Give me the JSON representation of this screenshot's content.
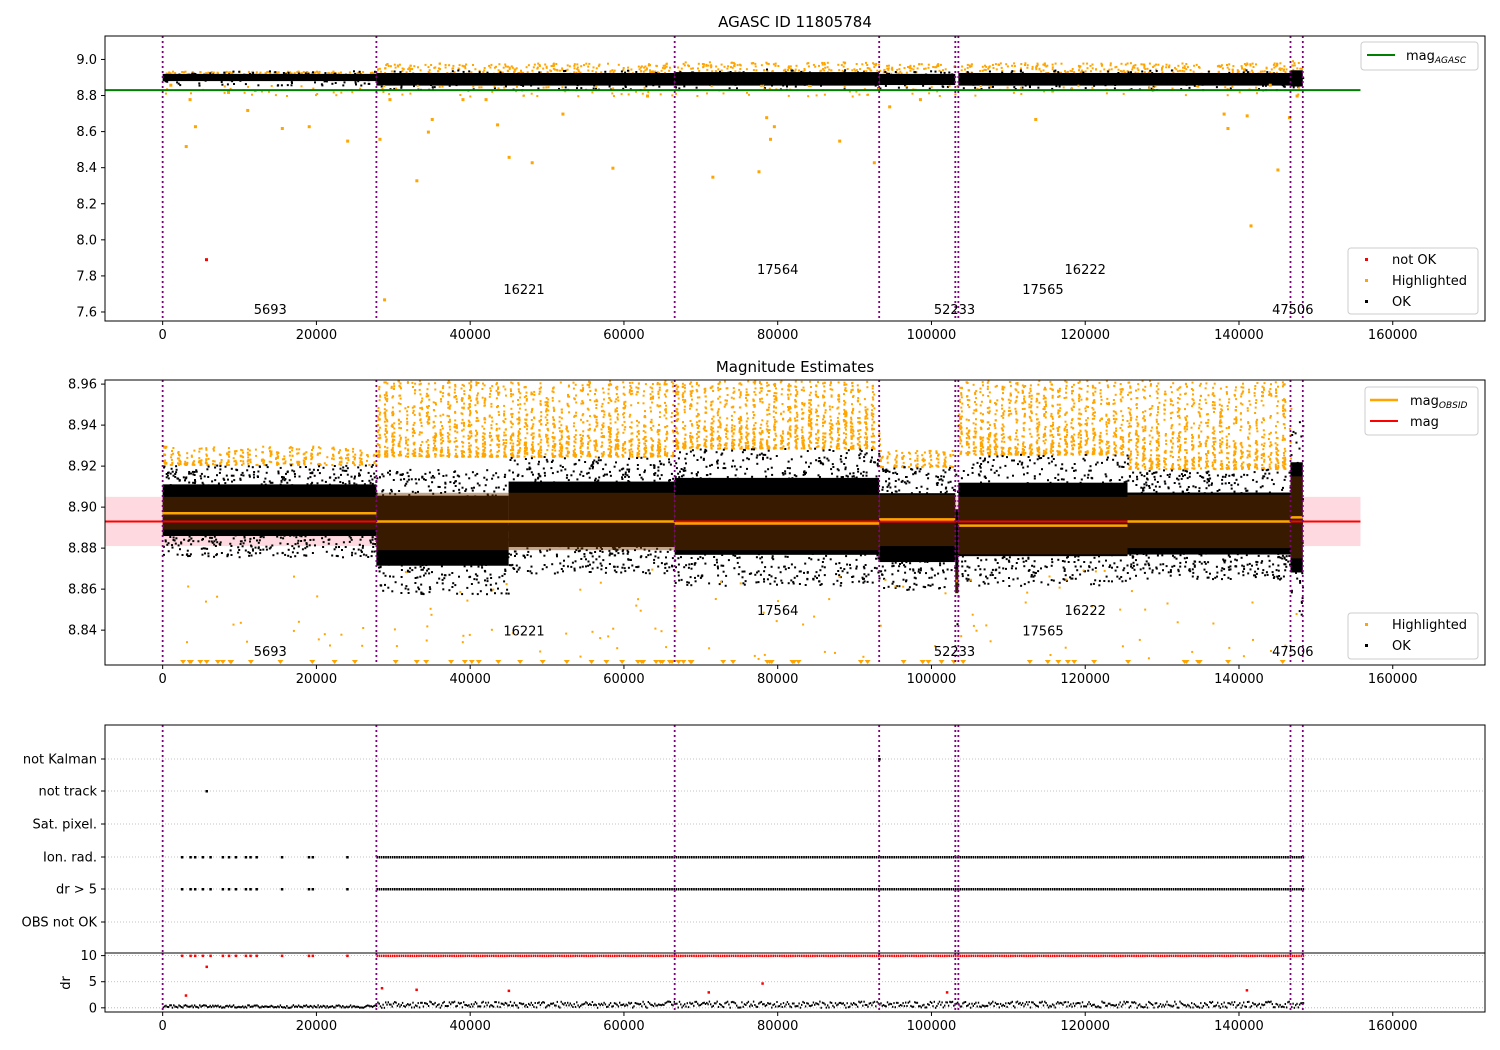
{
  "figure": {
    "panel1_title": "AGASC ID 11805784",
    "panel2_title": "Magnitude Estimates"
  },
  "colors": {
    "ok": "#000000",
    "highlighted": "#ffa500",
    "not_ok": "#ff0000",
    "mag_agasc": "#008000",
    "mag_line": "#ff0000",
    "mag_band": "#ffc0cb",
    "obsid_band": "#7a3a00",
    "obsid_line": "#ffa500",
    "boundary": "#800080",
    "grid": "#b0b0b0"
  },
  "chart_data": [
    {
      "type": "scatter",
      "title": "AGASC ID 11805784",
      "xlabel": "",
      "ylabel": "",
      "xlim": [
        -7500,
        172000
      ],
      "ylim": [
        7.55,
        9.13
      ],
      "xticks": [
        0,
        20000,
        40000,
        60000,
        80000,
        100000,
        120000,
        140000,
        160000
      ],
      "xtick_labels": [
        "0",
        "20000",
        "40000",
        "60000",
        "80000",
        "100000",
        "120000",
        "140000",
        "160000"
      ],
      "yticks": [
        7.6,
        7.8,
        8.0,
        8.2,
        8.4,
        8.6,
        8.8,
        9.0
      ],
      "ytick_labels": [
        "7.6",
        "7.8",
        "8.0",
        "8.2",
        "8.4",
        "8.6",
        "8.8",
        "9.0"
      ],
      "hlines": [
        {
          "name": "mag_AGASC",
          "y": 8.83,
          "x": [
            -7500,
            155800
          ]
        }
      ],
      "obsid_boundaries": [
        0,
        27800,
        66600,
        93200,
        103100,
        103500,
        146700,
        148300
      ],
      "obsid_labels": [
        {
          "text": "5693",
          "x": 14000,
          "y": 7.59
        },
        {
          "text": "16221",
          "x": 47000,
          "y": 7.7
        },
        {
          "text": "17564",
          "x": 80000,
          "y": 7.81
        },
        {
          "text": "52233",
          "x": 103000,
          "y": 7.59
        },
        {
          "text": "17565",
          "x": 114500,
          "y": 7.7
        },
        {
          "text": "16222",
          "x": 120000,
          "y": 7.81
        },
        {
          "text": "47506",
          "x": 147000,
          "y": 7.59
        }
      ],
      "ok_band_segments": [
        {
          "x": [
            0,
            27800
          ],
          "y_low": 8.88,
          "y_high": 8.92
        },
        {
          "x": [
            27800,
            66600
          ],
          "y_low": 8.855,
          "y_high": 8.925
        },
        {
          "x": [
            66600,
            93200
          ],
          "y_low": 8.855,
          "y_high": 8.93
        },
        {
          "x": [
            93200,
            103100
          ],
          "y_low": 8.858,
          "y_high": 8.92
        },
        {
          "x": [
            103500,
            146700
          ],
          "y_low": 8.855,
          "y_high": 8.925
        },
        {
          "x": [
            146700,
            148300
          ],
          "y_low": 8.85,
          "y_high": 8.94
        }
      ],
      "highlighted_outliers": [
        [
          1000,
          8.86
        ],
        [
          3000,
          8.52
        ],
        [
          3500,
          8.78
        ],
        [
          4200,
          8.63
        ],
        [
          8500,
          8.82
        ],
        [
          11000,
          8.72
        ],
        [
          15500,
          8.62
        ],
        [
          19000,
          8.63
        ],
        [
          24000,
          8.55
        ],
        [
          28200,
          8.56
        ],
        [
          28800,
          7.67
        ],
        [
          29500,
          8.78
        ],
        [
          33000,
          8.33
        ],
        [
          34500,
          8.6
        ],
        [
          35000,
          8.67
        ],
        [
          39000,
          8.78
        ],
        [
          42000,
          8.78
        ],
        [
          43500,
          8.64
        ],
        [
          45000,
          8.46
        ],
        [
          48000,
          8.43
        ],
        [
          52000,
          8.7
        ],
        [
          58500,
          8.4
        ],
        [
          63000,
          8.8
        ],
        [
          71500,
          8.35
        ],
        [
          77500,
          8.38
        ],
        [
          78500,
          8.68
        ],
        [
          79000,
          8.56
        ],
        [
          79500,
          8.63
        ],
        [
          88000,
          8.55
        ],
        [
          92500,
          8.43
        ],
        [
          94500,
          8.74
        ],
        [
          98500,
          8.78
        ],
        [
          113500,
          8.67
        ],
        [
          138000,
          8.7
        ],
        [
          138500,
          8.62
        ],
        [
          141000,
          8.69
        ],
        [
          141500,
          8.08
        ],
        [
          144000,
          8.86
        ],
        [
          145000,
          8.39
        ],
        [
          146500,
          8.68
        ],
        [
          147500,
          8.8
        ]
      ],
      "not_ok_points": [
        [
          5700,
          7.89
        ]
      ],
      "legend": {
        "location": "upper right / lower right",
        "entries": [
          "mag_AGASC",
          "not OK",
          "Highlighted",
          "OK"
        ]
      }
    },
    {
      "type": "scatter",
      "title": "Magnitude Estimates",
      "xlabel": "",
      "ylabel": "",
      "xlim": [
        -7500,
        172000
      ],
      "ylim": [
        8.823,
        8.962
      ],
      "xticks": [
        0,
        20000,
        40000,
        60000,
        80000,
        100000,
        120000,
        140000,
        160000
      ],
      "xtick_labels": [
        "0",
        "20000",
        "40000",
        "60000",
        "80000",
        "100000",
        "120000",
        "140000",
        "160000"
      ],
      "yticks": [
        8.84,
        8.86,
        8.88,
        8.9,
        8.92,
        8.94,
        8.96
      ],
      "ytick_labels": [
        "8.84",
        "8.86",
        "8.88",
        "8.90",
        "8.92",
        "8.94",
        "8.96"
      ],
      "mag": {
        "value": 8.893,
        "band": [
          8.881,
          8.905
        ],
        "x": [
          -7500,
          155800
        ]
      },
      "mag_obsid": [
        {
          "x": [
            0,
            27800
          ],
          "value": 8.897,
          "band": [
            8.889,
            8.905
          ]
        },
        {
          "x": [
            27800,
            66600
          ],
          "value": 8.893,
          "band": [
            8.879,
            8.907
          ]
        },
        {
          "x": [
            66600,
            93200
          ],
          "value": 8.892,
          "band": [
            8.879,
            8.906
          ]
        },
        {
          "x": [
            93200,
            103100
          ],
          "value": 8.894,
          "band": [
            8.881,
            8.906
          ]
        },
        {
          "x": [
            103100,
            103500
          ],
          "value": 8.864,
          "band": [
            8.858,
            8.87
          ]
        },
        {
          "x": [
            103500,
            125500
          ],
          "value": 8.891,
          "band": [
            8.877,
            8.905
          ]
        },
        {
          "x": [
            125500,
            146700
          ],
          "value": 8.893,
          "band": [
            8.88,
            8.906
          ]
        },
        {
          "x": [
            146700,
            148300
          ],
          "value": 8.895,
          "band": [
            8.875,
            8.915
          ]
        }
      ],
      "obsid_boundaries": [
        0,
        27800,
        66600,
        93200,
        103100,
        103500,
        146700,
        148300
      ],
      "obsid_labels": [
        {
          "text": "5693",
          "x": 14000,
          "y": 8.8275
        },
        {
          "text": "16221",
          "x": 47000,
          "y": 8.8375
        },
        {
          "text": "17564",
          "x": 80000,
          "y": 8.8475
        },
        {
          "text": "52233",
          "x": 103000,
          "y": 8.8275
        },
        {
          "text": "17565",
          "x": 114500,
          "y": 8.8375
        },
        {
          "text": "16222",
          "x": 120000,
          "y": 8.8475
        },
        {
          "text": "47506",
          "x": 147000,
          "y": 8.8275
        }
      ],
      "ok_spread": [
        {
          "x": [
            0,
            27800
          ],
          "low": 8.876,
          "high": 8.921
        },
        {
          "x": [
            27800,
            45000
          ],
          "low": 8.858,
          "high": 8.919
        },
        {
          "x": [
            45000,
            66600
          ],
          "low": 8.868,
          "high": 8.925
        },
        {
          "x": [
            66600,
            93200
          ],
          "low": 8.862,
          "high": 8.929
        },
        {
          "x": [
            93200,
            103100
          ],
          "low": 8.86,
          "high": 8.92
        },
        {
          "x": [
            103100,
            103500
          ],
          "low": 8.842,
          "high": 8.915
        },
        {
          "x": [
            103500,
            125500
          ],
          "low": 8.862,
          "high": 8.926
        },
        {
          "x": [
            125500,
            146700
          ],
          "low": 8.865,
          "high": 8.919
        },
        {
          "x": [
            146700,
            148300
          ],
          "low": 8.847,
          "high": 8.943
        }
      ],
      "highlighted_spread": [
        {
          "x": [
            0,
            27800
          ],
          "low": 8.921,
          "high": 8.93
        },
        {
          "x": [
            27800,
            66600
          ],
          "low": 8.925,
          "high": 8.962
        },
        {
          "x": [
            66600,
            93200
          ],
          "low": 8.929,
          "high": 8.962
        },
        {
          "x": [
            93200,
            103100
          ],
          "low": 8.92,
          "high": 8.928
        },
        {
          "x": [
            103500,
            125500
          ],
          "low": 8.926,
          "high": 8.962
        },
        {
          "x": [
            125500,
            146700
          ],
          "low": 8.919,
          "high": 8.962
        }
      ],
      "legend": {
        "location": "upper right / lower right",
        "entries": [
          "mag_OBSID",
          "mag",
          "Highlighted",
          "OK"
        ]
      }
    },
    {
      "type": "scatter",
      "title": "",
      "xlabel": "",
      "ylabel": "",
      "categories": [
        "not Kalman",
        "not track",
        "Sat. pixel.",
        "Ion. rad.",
        "dr > 5",
        "OBS not OK"
      ],
      "flag_points": {
        "not Kalman": [
          93200
        ],
        "not track": [
          5700
        ],
        "Sat. pixel.": [],
        "Ion. rad.": {
          "sparse_x": [
            2500,
            3600,
            4200,
            5200,
            6200,
            7800,
            8600,
            9500,
            10800,
            11400,
            12200,
            15500,
            19000,
            19500,
            24000
          ],
          "dense_range": [
            27800,
            148300
          ]
        },
        "dr > 5": {
          "sparse_x": [
            2500,
            3600,
            4200,
            5200,
            6200,
            7800,
            8600,
            9500,
            10800,
            11400,
            12200,
            15500,
            19000,
            19500,
            24000
          ],
          "dense_range": [
            27800,
            148300
          ]
        },
        "OBS not OK": []
      }
    },
    {
      "type": "scatter",
      "title": "",
      "xlabel": "",
      "ylabel": "dr",
      "xlim": [
        -7500,
        172000
      ],
      "ylim": [
        -0.8,
        10.5
      ],
      "xticks": [
        0,
        20000,
        40000,
        60000,
        80000,
        100000,
        120000,
        140000,
        160000
      ],
      "xtick_labels": [
        "0",
        "20000",
        "40000",
        "60000",
        "80000",
        "100000",
        "120000",
        "140000",
        "160000"
      ],
      "yticks": [
        0,
        5,
        10
      ],
      "ytick_labels": [
        "0",
        "5",
        "10"
      ],
      "clipped_value": 10,
      "dr_outliers": [
        [
          3000,
          2.4
        ],
        [
          5700,
          7.9
        ],
        [
          28500,
          3.8
        ],
        [
          33000,
          3.5
        ],
        [
          45000,
          3.3
        ],
        [
          71000,
          3.0
        ],
        [
          78000,
          4.7
        ],
        [
          102000,
          3.0
        ],
        [
          141000,
          3.4
        ]
      ]
    }
  ],
  "panel1_legend_top": {
    "mag_agasc_label": "mag",
    "mag_agasc_sub": "AGASC"
  },
  "panel1_legend_bottom": {
    "not_ok_label": "not OK",
    "highlighted_label": "Highlighted",
    "ok_label": "OK"
  },
  "panel2_legend_top": {
    "mag_obsid_label": "mag",
    "mag_obsid_sub": "OBSID",
    "mag_label": "mag"
  },
  "panel2_legend_bottom": {
    "highlighted_label": "Highlighted",
    "ok_label": "OK"
  },
  "panel4_ylabel": "dr"
}
